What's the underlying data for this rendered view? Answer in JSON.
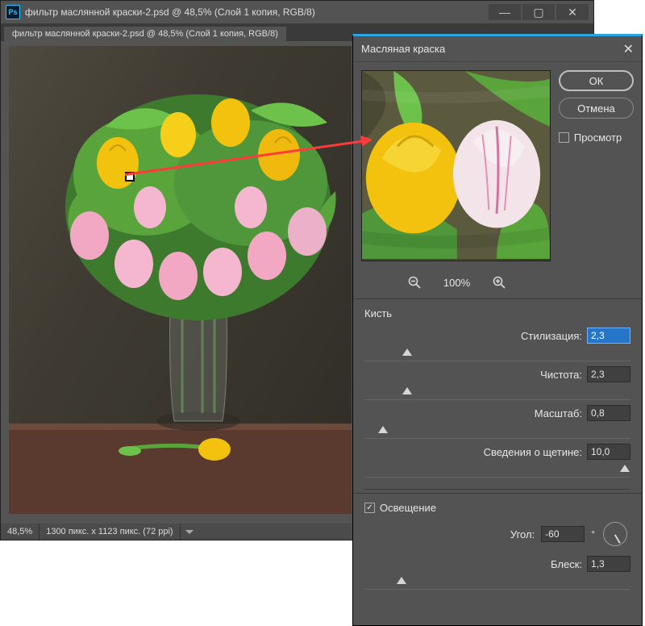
{
  "mainWindow": {
    "appIcon": "Ps",
    "title": "фильтр маслянной краски-2.psd @ 48,5% (Слой 1 копия, RGB/8)",
    "tabTitle": "фильтр маслянной краски-2.psd @ 48,5% (Слой 1 копия, RGB/8)",
    "status": {
      "zoom": "48,5%",
      "dims": "1300 пикс. x 1123 пикс. (72 ppi)"
    }
  },
  "dialog": {
    "title": "Масляная краска",
    "buttons": {
      "ok": "ОК",
      "cancel": "Отмена"
    },
    "previewCheck": {
      "checked": false,
      "label": "Просмотр"
    },
    "zoom": {
      "level": "100%"
    },
    "brushSection": "Кисть",
    "params": {
      "stylization": {
        "label": "Стилизация:",
        "value": "2,3",
        "thumbPct": 16
      },
      "cleanliness": {
        "label": "Чистота:",
        "value": "2,3",
        "thumbPct": 16
      },
      "scale": {
        "label": "Масштаб:",
        "value": "0,8",
        "thumbPct": 7
      },
      "bristle": {
        "label": "Сведения о щетине:",
        "value": "10,0",
        "thumbPct": 98
      }
    },
    "lightingSection": {
      "label": "Освещение",
      "checked": true
    },
    "angle": {
      "label": "Угол:",
      "value": "-60"
    },
    "shine": {
      "label": "Блеск:",
      "value": "1,3",
      "thumbPct": 14
    }
  }
}
